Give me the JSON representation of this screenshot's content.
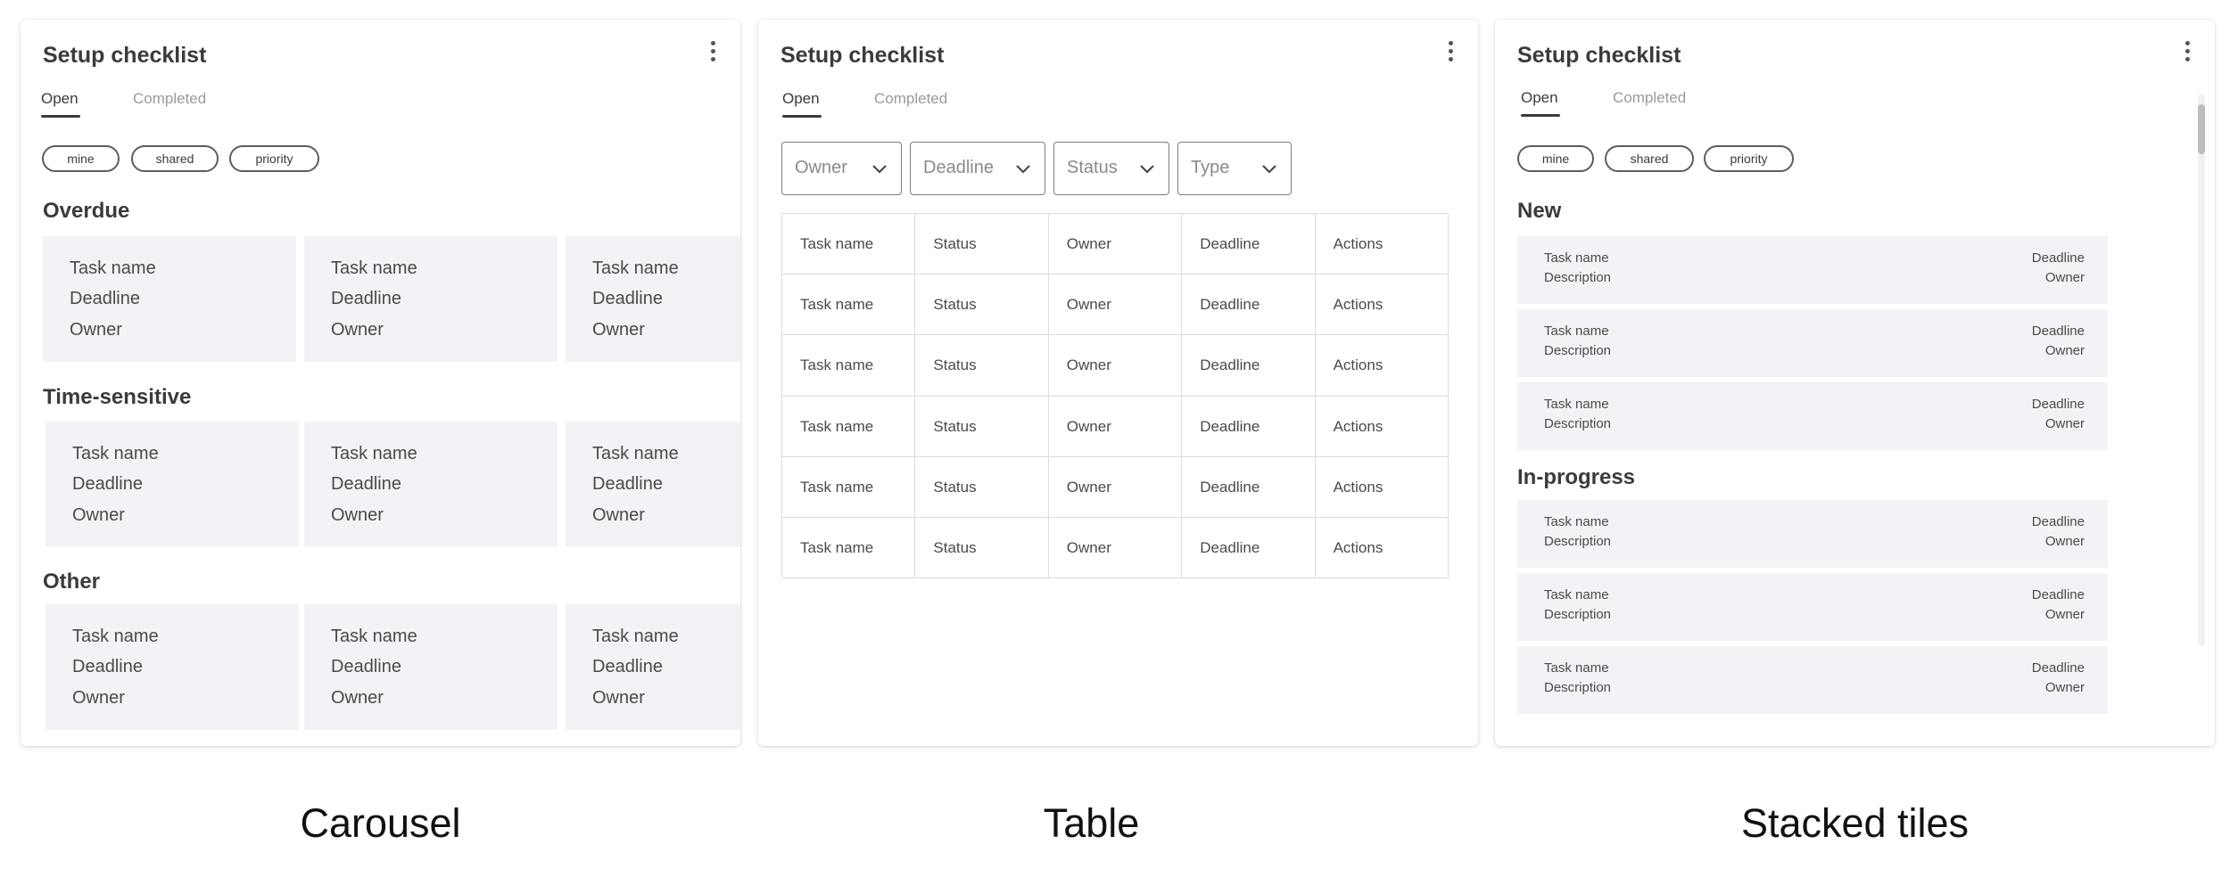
{
  "panels": [
    {
      "title": "Setup checklist",
      "tabs": [
        "Open",
        "Completed"
      ],
      "chips": [
        "mine",
        "shared",
        "priority"
      ],
      "sections": [
        {
          "heading": "Overdue",
          "cards": [
            {
              "name": "Task name",
              "deadline": "Deadline",
              "owner": "Owner"
            },
            {
              "name": "Task name",
              "deadline": "Deadline",
              "owner": "Owner"
            },
            {
              "name": "Task name",
              "deadline": "Deadline",
              "owner": "Owner"
            }
          ]
        },
        {
          "heading": "Time-sensitive",
          "cards": [
            {
              "name": "Task name",
              "deadline": "Deadline",
              "owner": "Owner"
            },
            {
              "name": "Task name",
              "deadline": "Deadline",
              "owner": "Owner"
            },
            {
              "name": "Task name",
              "deadline": "Deadline",
              "owner": "Owner"
            }
          ]
        },
        {
          "heading": "Other",
          "cards": [
            {
              "name": "Task name",
              "deadline": "Deadline",
              "owner": "Owner"
            },
            {
              "name": "Task name",
              "deadline": "Deadline",
              "owner": "Owner"
            },
            {
              "name": "Task name",
              "deadline": "Deadline",
              "owner": "Owner"
            }
          ]
        }
      ],
      "caption": "Carousel"
    },
    {
      "title": "Setup checklist",
      "tabs": [
        "Open",
        "Completed"
      ],
      "filters": [
        "Owner",
        "Deadline",
        "Status",
        "Type"
      ],
      "table": {
        "rows": [
          [
            "Task name",
            "Status",
            "Owner",
            "Deadline",
            "Actions"
          ],
          [
            "Task name",
            "Status",
            "Owner",
            "Deadline",
            "Actions"
          ],
          [
            "Task name",
            "Status",
            "Owner",
            "Deadline",
            "Actions"
          ],
          [
            "Task name",
            "Status",
            "Owner",
            "Deadline",
            "Actions"
          ],
          [
            "Task name",
            "Status",
            "Owner",
            "Deadline",
            "Actions"
          ],
          [
            "Task name",
            "Status",
            "Owner",
            "Deadline",
            "Actions"
          ]
        ]
      },
      "caption": "Table"
    },
    {
      "title": "Setup checklist",
      "tabs": [
        "Open",
        "Completed"
      ],
      "chips": [
        "mine",
        "shared",
        "priority"
      ],
      "sections": [
        {
          "heading": "New",
          "tiles": [
            {
              "name": "Task name",
              "description": "Description",
              "deadline": "Deadline",
              "owner": "Owner"
            },
            {
              "name": "Task name",
              "description": "Description",
              "deadline": "Deadline",
              "owner": "Owner"
            },
            {
              "name": "Task name",
              "description": "Description",
              "deadline": "Deadline",
              "owner": "Owner"
            }
          ]
        },
        {
          "heading": "In-progress",
          "tiles": [
            {
              "name": "Task name",
              "description": "Description",
              "deadline": "Deadline",
              "owner": "Owner"
            },
            {
              "name": "Task name",
              "description": "Description",
              "deadline": "Deadline",
              "owner": "Owner"
            },
            {
              "name": "Task name",
              "description": "Description",
              "deadline": "Deadline",
              "owner": "Owner"
            }
          ]
        }
      ],
      "caption": "Stacked tiles"
    }
  ]
}
